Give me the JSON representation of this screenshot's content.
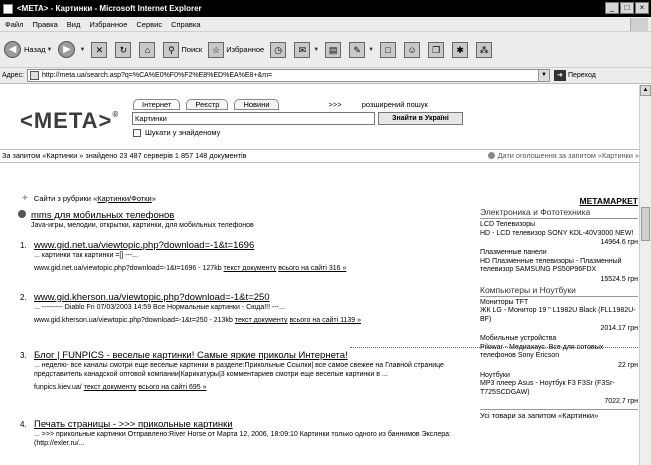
{
  "window": {
    "title": "<META> - Картинки - Microsoft Internet Explorer",
    "buttons": [
      "_",
      "□",
      "×"
    ]
  },
  "menu": [
    "Файл",
    "Правка",
    "Вид",
    "Избранное",
    "Сервис",
    "Справка"
  ],
  "toolbar": {
    "back": "Назад",
    "search": "Поиск",
    "favorites": "Избранное"
  },
  "address": {
    "label": "Адрес:",
    "url": "http://meta.ua/search.asp?q=%CA%E0%F0%F2%E8%ED%EA%E8+&m=",
    "go": "Переход"
  },
  "brand": {
    "logo": "<META>",
    "reg": "®"
  },
  "search": {
    "tabs": [
      "Інтернет",
      "Реєстр",
      "Новини"
    ],
    "more": ">>>",
    "extended": "розширений пошук",
    "query": "Картинки",
    "button": "Знайти в Україні",
    "checkbox_label": "Шукати у знайденому"
  },
  "summary": {
    "text": "За запитом «Картинки » знайдено 23 487 серверів 1 857 148 документів",
    "ads_link": "Дати оголошення за запитом «Картинки »"
  },
  "category_line": {
    "prefix": "Сайти з рубрики «",
    "link": "Картинки/Фотки",
    "suffix": "»"
  },
  "special_result": {
    "title": "mms для мобильных телефонов",
    "desc": "Java-игры, мелодии, открытки, картинки, для мобильных телефонов"
  },
  "results": [
    {
      "num": "1.",
      "title": "www.gid.net.ua/viewtopic.php?download=-1&t=1696",
      "desc": "... картинки так картинки =[] ---...",
      "url": "www.gid.net.ua/viewtopic.php?download=-1&t=1696",
      "size": "- 127kb",
      "link1": "текст документу",
      "link2": "всього на сайті 316 »"
    },
    {
      "num": "2.",
      "title": "www.gid.kherson.ua/viewtopic.php?download=-1&t=250",
      "desc": "... --------- Diablo Fri 07/03/2003 14:59 Все Нормальные картинки - Сюда!!! ---...",
      "url": "www.gid.kherson.ua/viewtopic.php?download=-1&t=250",
      "size": "- 213kb",
      "link1": "текст документу",
      "link2": "всього на сайті 1139 »"
    },
    {
      "num": "3.",
      "title": "Блог | FUNPICS - веселые картинки! Самые яркие приколы Интернета!",
      "desc": "... неделю- все каналы смотри еще веселые картинки в разделе:Прикольные Ссылки| все самое свежее на Главной странице представитель канадской оптовой компании|Карикатуры|3 комментариев смотри еще веселые картинки в ...",
      "url": "funpics.kiev.ua/",
      "size": "",
      "link1": "текст документу",
      "link2": "всього на сайті 695 »"
    },
    {
      "num": "4.",
      "title": "Печать страницы - >>> прикольные картинки",
      "desc": "... >>> прикольные картинки Отправлено:River Horse от Марта 12, 2006, 18:09:10 Картинки только одного из баннимов Экслера: (http://exler.ru/...",
      "url": "",
      "size": "",
      "link1": "",
      "link2": ""
    }
  ],
  "sidebar": {
    "heading": "МЕТАМАРКЕТ",
    "categories": [
      {
        "name": "Электроника и Фототехника",
        "items": [
          {
            "group": "LCD Телевизоры",
            "text": "HD - LCD телевизор SONY KDL-40V3000 NEW!",
            "price": "14964.6 грн"
          },
          {
            "group": "Плазменные панели",
            "text": "HD Плазменные телевизоры - Плазменный телевизор SAMSUNG PS50P96FDX",
            "price": "15524.5 грн"
          }
        ]
      },
      {
        "name": "Компьютеры и Ноутбуки",
        "items": [
          {
            "group": "Мониторы TFT",
            "text": "ЖК LG - Монитор 19 \" L1982U Black (FLL1982U-BF)",
            "price": "2014.17 грн"
          },
          {
            "group": "Мобильные устройства",
            "text": "Pilowar - Медиахаус. Все для сотовых телефонов Sony Ericson",
            "price": "22 грн"
          },
          {
            "group": "Ноутбуки",
            "text": "MP3 плеер Asus - Ноутбук F3 F3Sr (F3Sr-T725SCDGAW)",
            "price": "7022.7 грн"
          }
        ]
      }
    ],
    "last": "Усі товари за запитом «Картинки»"
  }
}
